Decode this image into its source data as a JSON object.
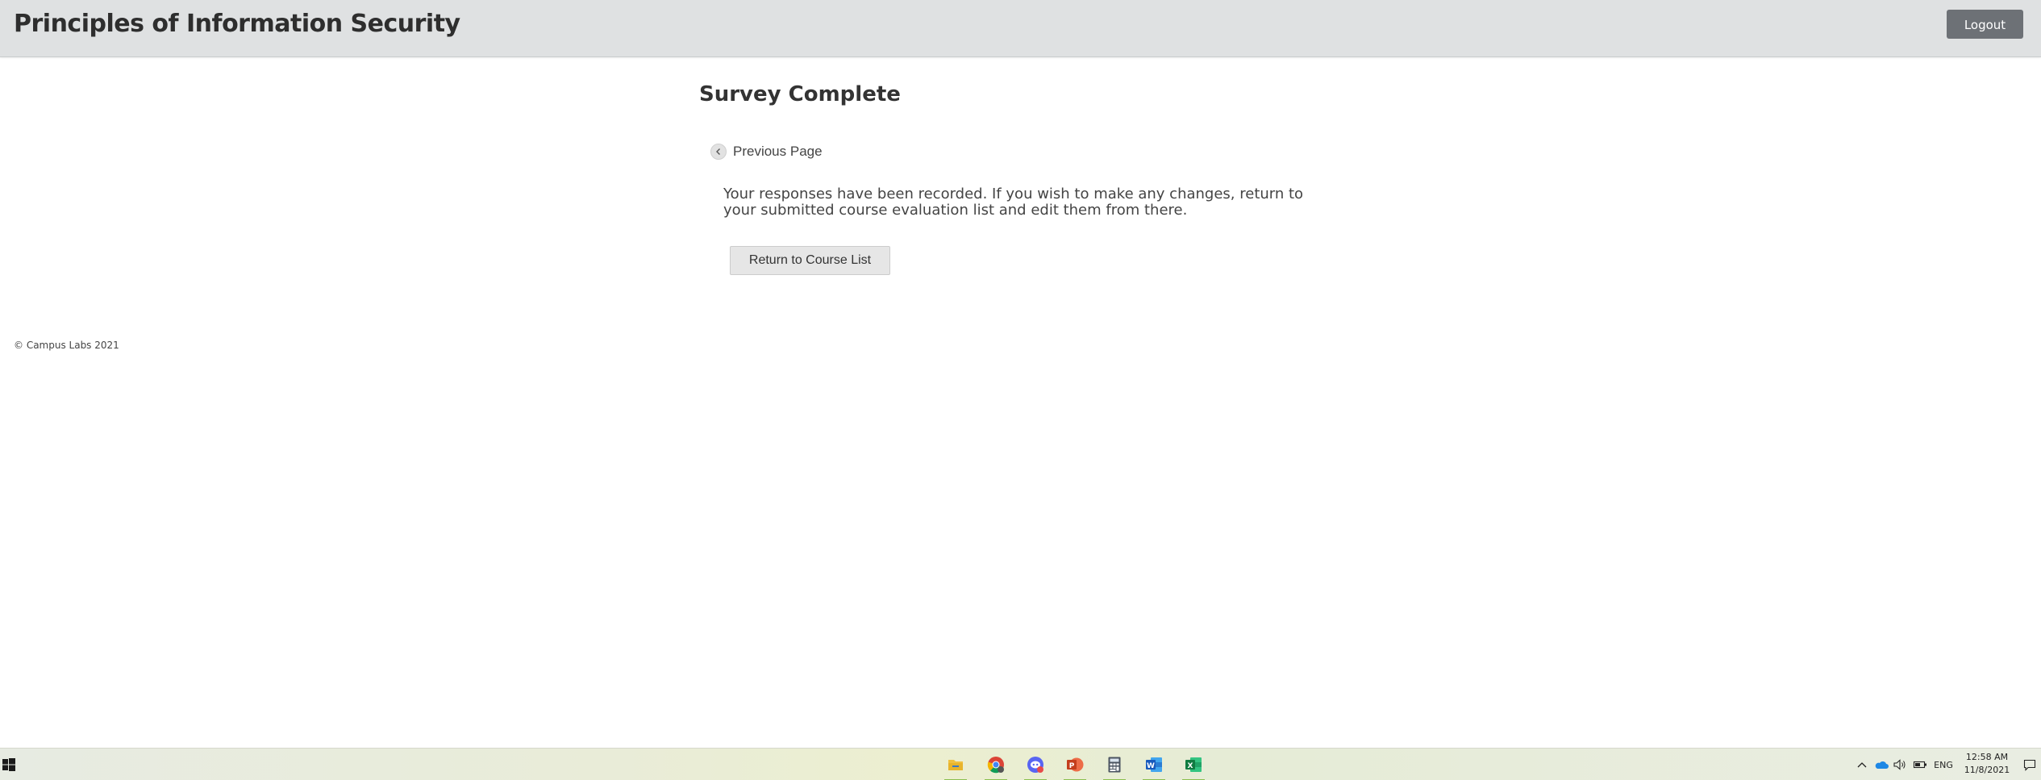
{
  "header": {
    "app_title": "Principles of Information Security",
    "logout_label": "Logout"
  },
  "main": {
    "page_title": "Survey Complete",
    "prev_link_label": "Previous Page",
    "message": "Your responses have been recorded. If you wish to make any changes, return to your submitted course evaluation list and edit them from there.",
    "return_button_label": "Return to Course List"
  },
  "footer": {
    "copyright": "© Campus Labs 2021"
  },
  "taskbar": {
    "start_icon": "windows-start-icon",
    "apps": [
      {
        "name": "file-explorer-icon",
        "color": "#e8b42c"
      },
      {
        "name": "chrome-icon",
        "color": "#db4437"
      },
      {
        "name": "discord-icon",
        "color": "#5865f2"
      },
      {
        "name": "powerpoint-icon",
        "color": "#d24726"
      },
      {
        "name": "calculator-icon",
        "color": "#4a5360"
      },
      {
        "name": "word-icon",
        "color": "#2b579a"
      },
      {
        "name": "excel-icon",
        "color": "#217346"
      }
    ],
    "language": "ENG",
    "time": "12:58 AM",
    "date": "11/8/2021"
  },
  "colors": {
    "header_bg": "#dfe1e2",
    "logout_bg": "#6d7176",
    "button_bg": "#e6e6e6"
  }
}
